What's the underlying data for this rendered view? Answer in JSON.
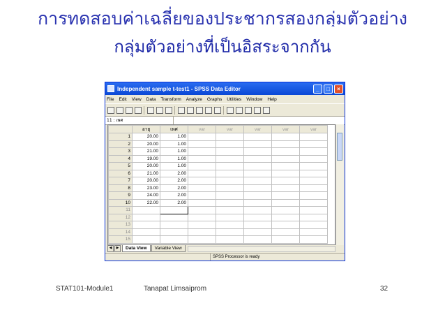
{
  "slide": {
    "title_line1": "การทดสอบค่าเฉลี่ยของประชากรสองกลุ่มตัวอย่าง",
    "title_line2": "กลุ่มตัวอย่างที่เป็นอิสระจากกัน",
    "footer_course": "STAT101-Module1",
    "footer_author": "Tanapat Limsaiprom",
    "page_number": "32"
  },
  "window": {
    "title": "Independent sample t-test1 - SPSS Data Editor",
    "menu": [
      "File",
      "Edit",
      "View",
      "Data",
      "Transform",
      "Analyze",
      "Graphs",
      "Utilities",
      "Window",
      "Help"
    ],
    "cell_reference": "11 : เพศ",
    "columns": [
      "อายุ",
      "เพศ",
      "var",
      "var",
      "var",
      "var",
      "var"
    ],
    "rows": [
      {
        "n": "1",
        "age": "20.00",
        "sex": "1.00"
      },
      {
        "n": "2",
        "age": "20.00",
        "sex": "1.00"
      },
      {
        "n": "3",
        "age": "21.00",
        "sex": "1.00"
      },
      {
        "n": "4",
        "age": "19.00",
        "sex": "1.00"
      },
      {
        "n": "5",
        "age": "20.00",
        "sex": "1.00"
      },
      {
        "n": "6",
        "age": "21.00",
        "sex": "2.00"
      },
      {
        "n": "7",
        "age": "20.00",
        "sex": "2.00"
      },
      {
        "n": "8",
        "age": "23.00",
        "sex": "2.00"
      },
      {
        "n": "9",
        "age": "24.00",
        "sex": "2.00"
      },
      {
        "n": "10",
        "age": "22.00",
        "sex": "2.00"
      }
    ],
    "empty_rows": [
      "11",
      "12",
      "13",
      "14",
      "15"
    ],
    "tab_data_view": "Data View",
    "tab_variable_view": "Variable View",
    "status": "SPSS Processor  is ready"
  }
}
